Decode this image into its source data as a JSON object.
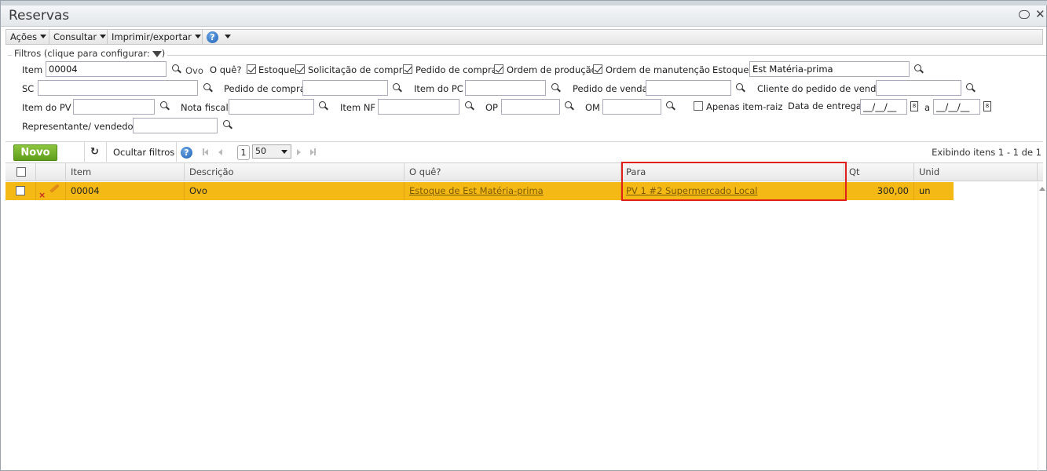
{
  "window": {
    "title": "Reservas"
  },
  "menubar": {
    "acoes": "Ações",
    "consultar": "Consultar",
    "imprimir": "Imprimir/exportar",
    "help": "?"
  },
  "filters": {
    "legend": "Filtros (clique para configurar:",
    "legend_close": ")",
    "item_label": "Item",
    "item_value": "00004",
    "item_desc": "Ovo",
    "oque_label": "O quê?",
    "checks": [
      {
        "label": "Estoque",
        "checked": true
      },
      {
        "label": "Solicitação de compra",
        "checked": true
      },
      {
        "label": "Pedido de compra",
        "checked": true
      },
      {
        "label": "Ordem de produção",
        "checked": true
      },
      {
        "label": "Ordem de manutenção",
        "checked": true
      }
    ],
    "estoque_label": "Estoque",
    "estoque_value": "Est Matéria-prima",
    "sc_label": "SC",
    "pedido_compra_label": "Pedido de compra",
    "item_pc_label": "Item do PC",
    "pedido_venda_label": "Pedido de venda",
    "cliente_label": "Cliente do pedido de venda",
    "item_pv_label": "Item do PV",
    "nota_fiscal_label": "Nota fiscal",
    "item_nf_label": "Item NF",
    "op_label": "OP",
    "om_label": "OM",
    "apenas_label": "Apenas item-raiz",
    "data_entrega_label": "Data de entrega",
    "date_from": "__/__/__",
    "date_sep": "a",
    "date_to": "__/__/__",
    "representante_label": "Representante/ vendedor"
  },
  "toolbar": {
    "novo": "Novo",
    "ocultar": "Ocultar filtros",
    "page": "1",
    "page_size": "50",
    "exibindo": "Exibindo itens 1 - 1 de 1"
  },
  "grid": {
    "columns": [
      "Item",
      "Descrição",
      "O quê?",
      "Para",
      "Qt",
      "Unid"
    ],
    "rows": [
      {
        "item": "00004",
        "descricao": "Ovo",
        "oque": "Estoque de Est Matéria-prima",
        "para": "PV 1 #2 Supermercado Local",
        "qt": "300,00",
        "unid": "un"
      }
    ]
  },
  "colors": {
    "row_highlight": "#f5b916",
    "novo_green": "#6aab22",
    "annotation_red": "#e0201a"
  }
}
